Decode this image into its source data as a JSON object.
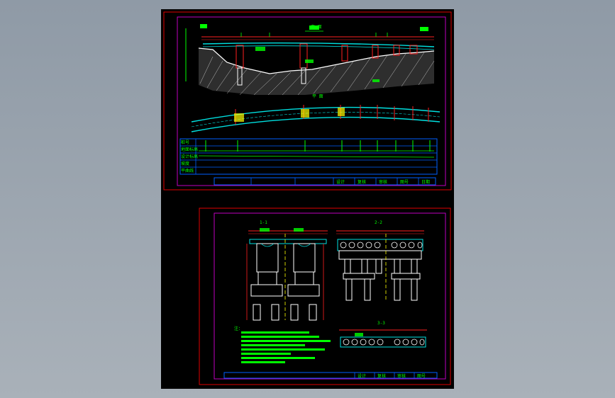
{
  "viewer": {
    "background_color": "#9aa4ae",
    "sheet_color": "#000000"
  },
  "sheet1": {
    "frame_color": "#e00000",
    "inner_frame_color": "#c000c0",
    "title": "立 面",
    "plan_title": "平 面",
    "title_block": [
      "设计",
      "复核",
      "审核",
      "图号",
      "日期"
    ],
    "colors": {
      "deck": "#00e0e0",
      "dim": "#ff2020",
      "text": "#00ff00",
      "ground": "#ffffff",
      "table": "#0060ff"
    },
    "table_rows": [
      "桩号",
      "地面标高",
      "设计标高",
      "坡度",
      "平曲线"
    ]
  },
  "sheet2": {
    "frame_color": "#e00000",
    "inner_frame_color": "#c000c0",
    "sections": [
      "1-1",
      "2-2",
      "3-3"
    ],
    "notes_title": "注：",
    "title_block": [
      "设计",
      "复核",
      "审核",
      "图号"
    ]
  }
}
